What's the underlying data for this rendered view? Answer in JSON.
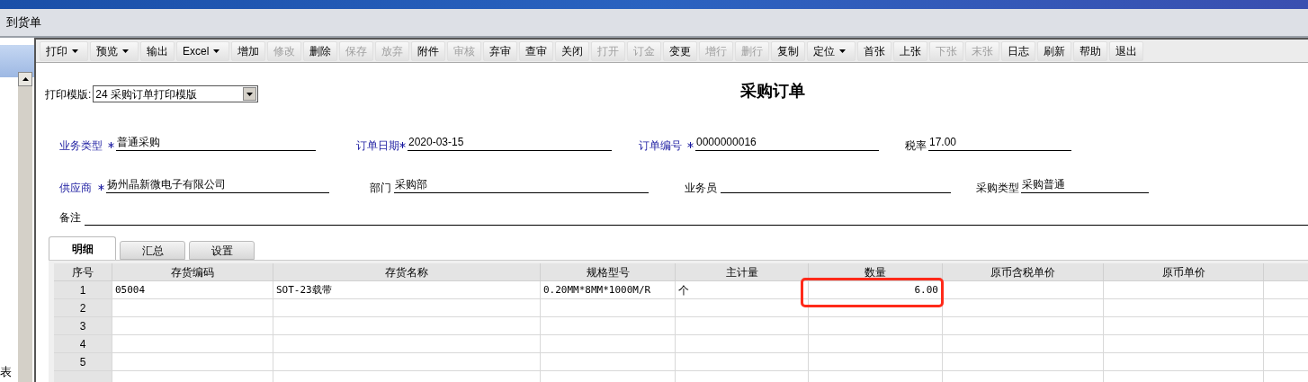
{
  "window_tab": {
    "title": "到货单"
  },
  "sidebar": {
    "text": "表"
  },
  "toolbar": [
    {
      "label": "打印",
      "dropdown": true,
      "disabled": false
    },
    {
      "label": "预览",
      "dropdown": true,
      "disabled": false
    },
    {
      "label": "输出",
      "dropdown": false,
      "disabled": false
    },
    {
      "label": "Excel",
      "dropdown": true,
      "disabled": false
    },
    {
      "label": "增加",
      "dropdown": false,
      "disabled": false
    },
    {
      "label": "修改",
      "dropdown": false,
      "disabled": true
    },
    {
      "label": "删除",
      "dropdown": false,
      "disabled": false
    },
    {
      "label": "保存",
      "dropdown": false,
      "disabled": true
    },
    {
      "label": "放弃",
      "dropdown": false,
      "disabled": true
    },
    {
      "label": "附件",
      "dropdown": false,
      "disabled": false
    },
    {
      "label": "审核",
      "dropdown": false,
      "disabled": true
    },
    {
      "label": "弃审",
      "dropdown": false,
      "disabled": false
    },
    {
      "label": "查审",
      "dropdown": false,
      "disabled": false
    },
    {
      "label": "关闭",
      "dropdown": false,
      "disabled": false
    },
    {
      "label": "打开",
      "dropdown": false,
      "disabled": true
    },
    {
      "label": "订金",
      "dropdown": false,
      "disabled": true
    },
    {
      "label": "变更",
      "dropdown": false,
      "disabled": false
    },
    {
      "label": "增行",
      "dropdown": false,
      "disabled": true
    },
    {
      "label": "删行",
      "dropdown": false,
      "disabled": true
    },
    {
      "label": "复制",
      "dropdown": false,
      "disabled": false
    },
    {
      "label": "定位",
      "dropdown": true,
      "disabled": false
    },
    {
      "label": "首张",
      "dropdown": false,
      "disabled": false
    },
    {
      "label": "上张",
      "dropdown": false,
      "disabled": false
    },
    {
      "label": "下张",
      "dropdown": false,
      "disabled": true
    },
    {
      "label": "末张",
      "dropdown": false,
      "disabled": true
    },
    {
      "label": "日志",
      "dropdown": false,
      "disabled": false
    },
    {
      "label": "刷新",
      "dropdown": false,
      "disabled": false
    },
    {
      "label": "帮助",
      "dropdown": false,
      "disabled": false
    },
    {
      "label": "退出",
      "dropdown": false,
      "disabled": false
    }
  ],
  "print_template": {
    "label": "打印模版:",
    "value": "24 采购订单打印模版"
  },
  "form_title": "采购订单",
  "field_rows": [
    [
      {
        "label": "业务类型",
        "required": true,
        "value": "普通采购"
      },
      {
        "label": "订单日期",
        "required": true,
        "value": "2020-03-15"
      },
      {
        "label": "订单编号",
        "required": true,
        "value": "0000000016"
      },
      {
        "label": "税率",
        "required": false,
        "value": "17.00"
      }
    ],
    [
      {
        "label": "供应商",
        "required": true,
        "value": "扬州晶新微电子有限公司"
      },
      {
        "label": "部门",
        "required": false,
        "value": "采购部"
      },
      {
        "label": "业务员",
        "required": false
      },
      {
        "label": "采购类型",
        "required": false,
        "value": "采购普通"
      }
    ]
  ],
  "remark": {
    "label": "备注"
  },
  "tabs": [
    {
      "label": "明细",
      "selected": true
    },
    {
      "label": "汇总",
      "selected": false
    },
    {
      "label": "设置",
      "selected": false
    }
  ],
  "table": {
    "columns": [
      {
        "label": "序号",
        "highlighted": false
      },
      {
        "label": "存货编码",
        "highlighted": false
      },
      {
        "label": "存货名称",
        "highlighted": false
      },
      {
        "label": "规格型号",
        "highlighted": false
      },
      {
        "label": "主计量",
        "highlighted": false
      },
      {
        "label": "数量",
        "highlighted": true
      },
      {
        "label": "原币含税单价",
        "highlighted": false
      },
      {
        "label": "原币单价",
        "highlighted": false
      }
    ],
    "rows": [
      [
        "1",
        "05004",
        "SOT-23载带",
        "0.20MM*8MM*1000M/R",
        "个",
        "6.00",
        "",
        ""
      ],
      [
        "2",
        "",
        "",
        "",
        "",
        "",
        "",
        ""
      ],
      [
        "3",
        "",
        "",
        "",
        "",
        "",
        "",
        ""
      ],
      [
        "4",
        "",
        "",
        "",
        "",
        "",
        "",
        ""
      ],
      [
        "5",
        "",
        "",
        "",
        "",
        "",
        "",
        ""
      ]
    ]
  }
}
